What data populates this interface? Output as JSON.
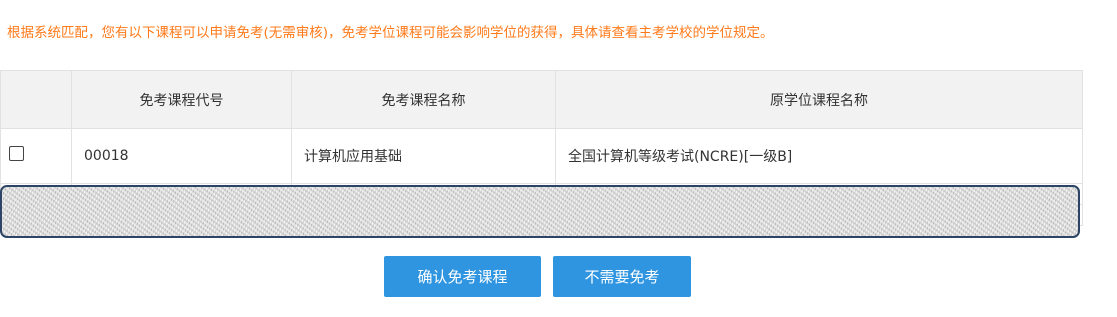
{
  "notice": "根据系统匹配，您有以下课程可以申请免考(无需审核)，免考学位课程可能会影响学位的获得，具体请查看主考学校的学位规定。",
  "table": {
    "headers": [
      "",
      "免考课程代号",
      "免考课程名称",
      "原学位课程名称"
    ],
    "rows": [
      {
        "code": "00018",
        "name": "计算机应用基础",
        "original": "全国计算机等级考试(NCRE)[一级B]"
      }
    ]
  },
  "buttons": {
    "confirm": "确认免考课程",
    "skip": "不需要免考"
  },
  "colors": {
    "notice": "#ff7a1a",
    "button": "#2f95e0",
    "header_bg": "#f2f2f2"
  }
}
